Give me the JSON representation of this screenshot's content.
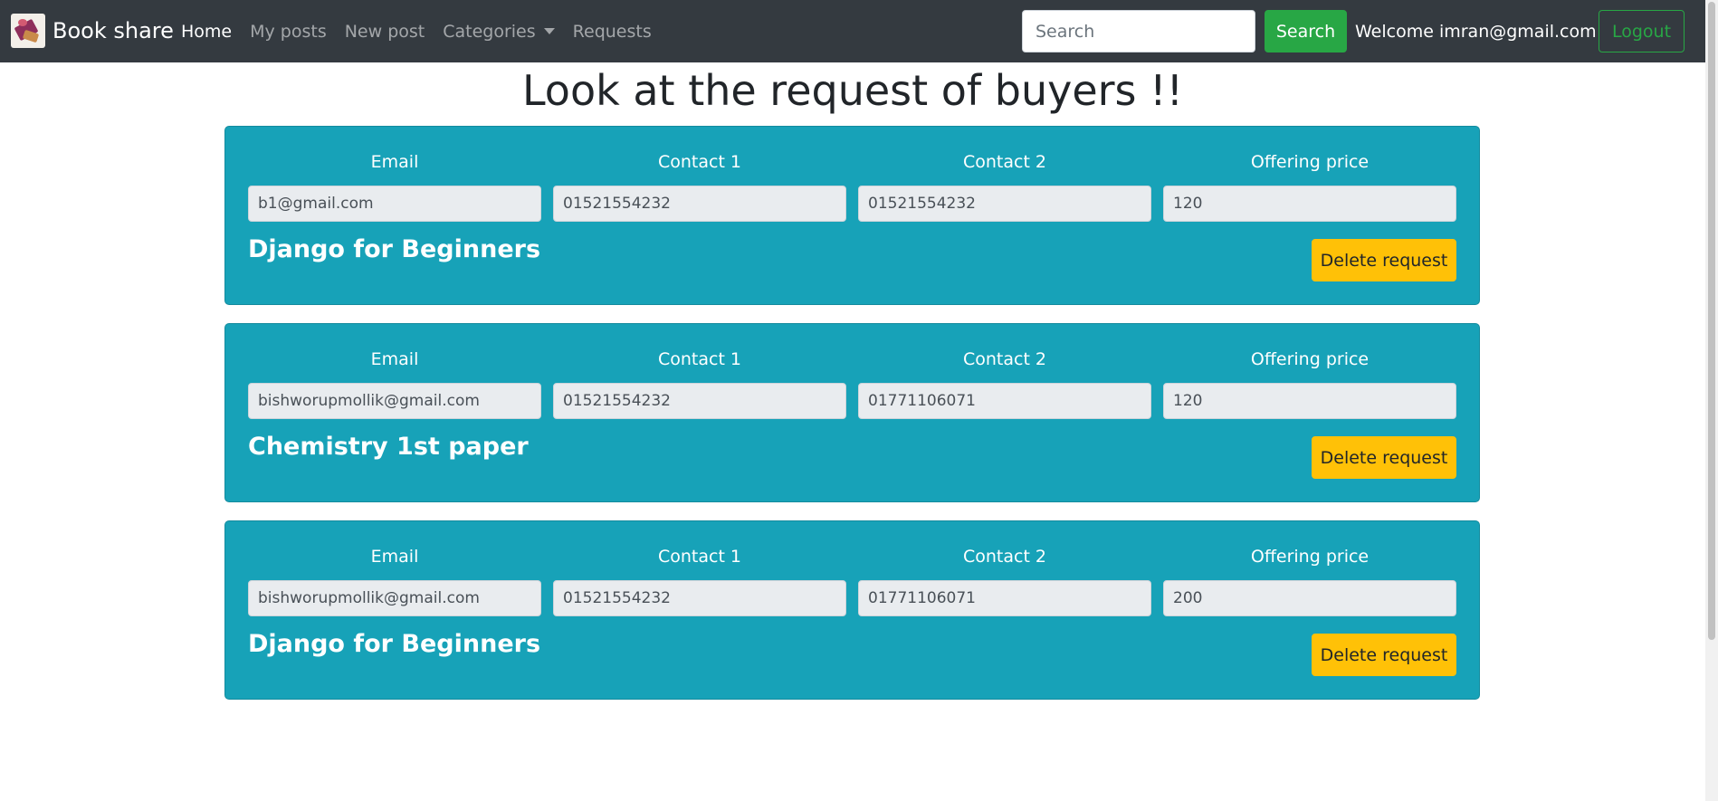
{
  "navbar": {
    "brand": "Book share",
    "links": [
      {
        "label": "Home",
        "active": true
      },
      {
        "label": "My posts"
      },
      {
        "label": "New post"
      },
      {
        "label": "Categories"
      },
      {
        "label": "Requests"
      }
    ],
    "search": {
      "placeholder": "Search",
      "button_label": "Search"
    },
    "welcome": "Welcome imran@gmail.com",
    "logout_label": "Logout"
  },
  "page": {
    "title": "Look at the request of buyers !!"
  },
  "labels": {
    "email": "Email",
    "contact1": "Contact 1",
    "contact2": "Contact 2",
    "price": "Offering price"
  },
  "requests": [
    {
      "email": "b1@gmail.com",
      "contact1": "01521554232",
      "contact2": "01521554232",
      "price": "120",
      "book": "Django for Beginners",
      "delete_label": "Delete request"
    },
    {
      "email": "bishworupmollik@gmail.com",
      "contact1": "01521554232",
      "contact2": "01771106071",
      "price": "120",
      "book": "Chemistry 1st paper",
      "delete_label": "Delete request"
    },
    {
      "email": "bishworupmollik@gmail.com",
      "contact1": "01521554232",
      "contact2": "01771106071",
      "price": "200",
      "book": "Django for Beginners",
      "delete_label": "Delete request"
    }
  ],
  "colors": {
    "navbar": "#343a40",
    "card": "#17a2b8",
    "success": "#28a745",
    "warning": "#ffc107"
  }
}
